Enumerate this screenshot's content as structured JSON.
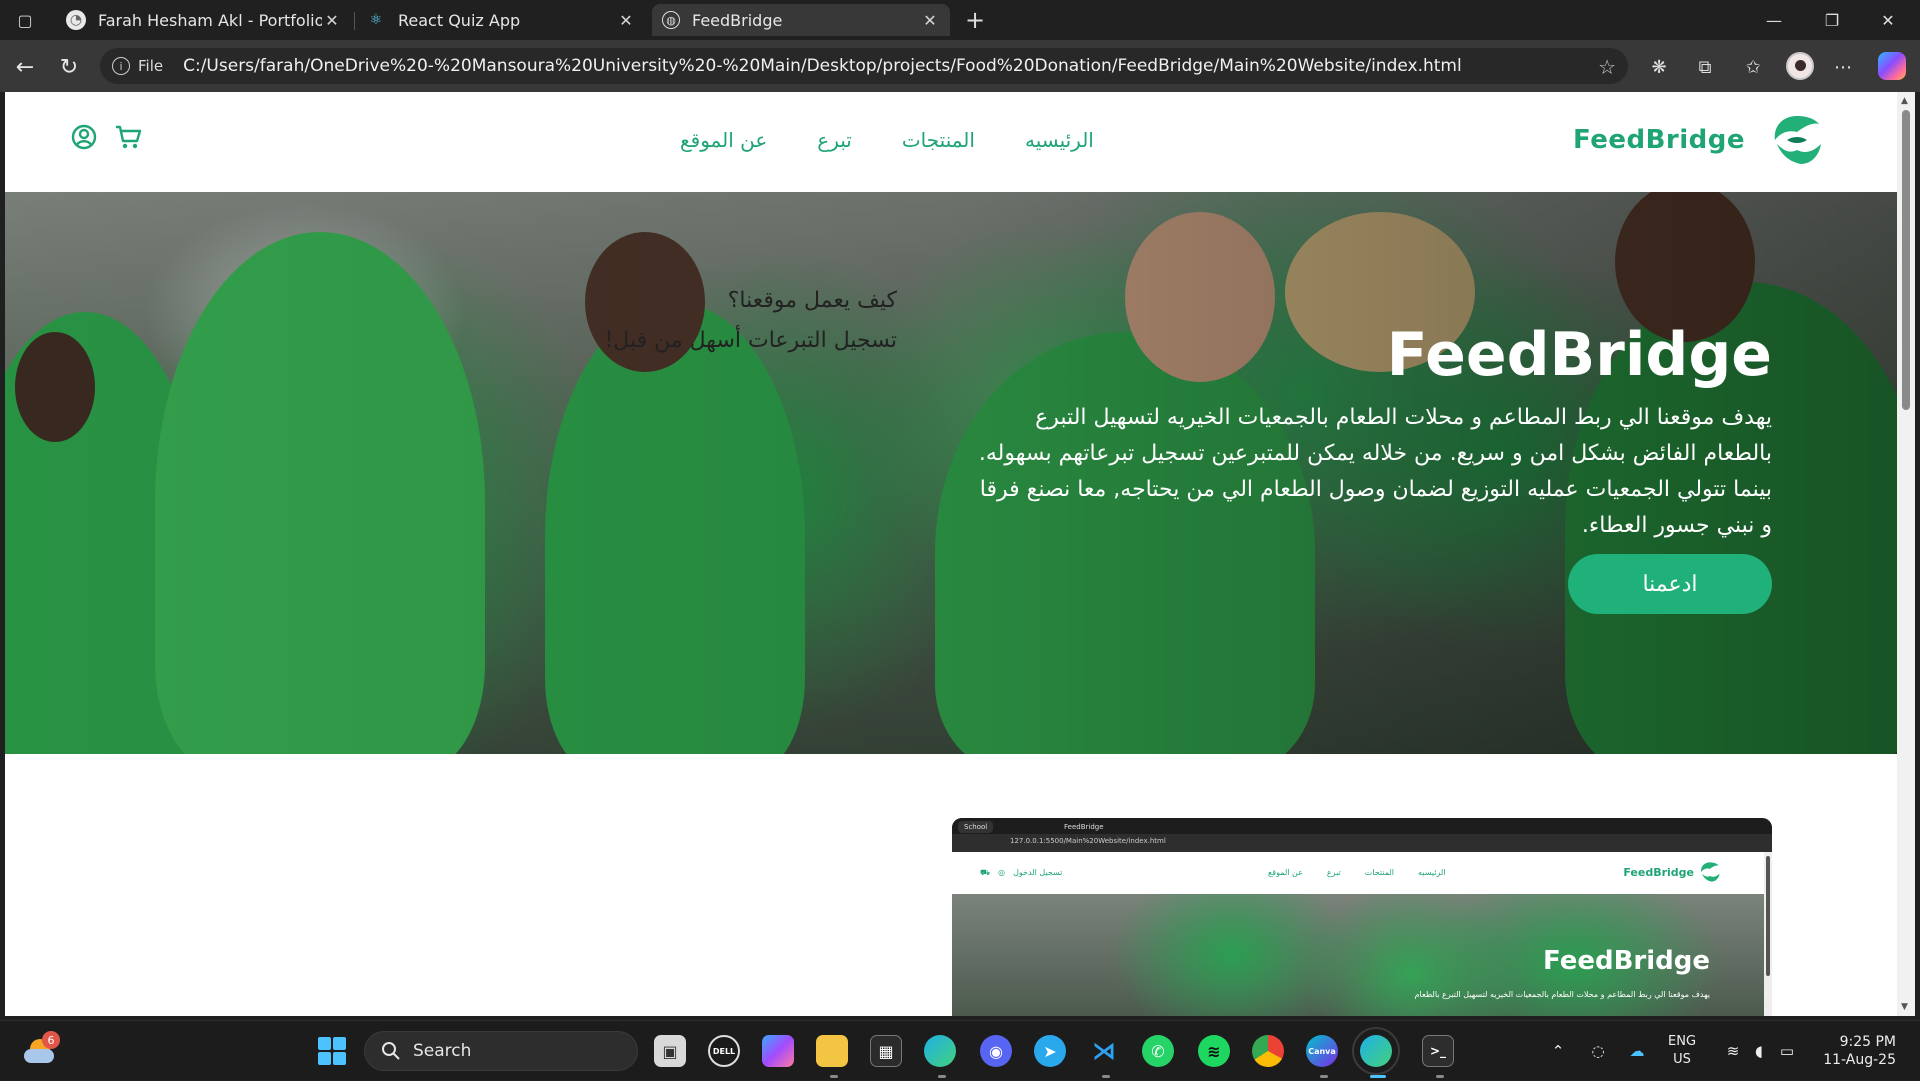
{
  "browser": {
    "tabs": [
      {
        "title": "Farah Hesham Akl - Portfolio",
        "active": false
      },
      {
        "title": "React Quiz App",
        "active": false
      },
      {
        "title": "FeedBridge",
        "active": true
      }
    ],
    "address": {
      "scheme_label": "File",
      "url": "C:/Users/farah/OneDrive%20-%20Mansoura%20University%20-%20Main/Desktop/projects/Food%20Donation/FeedBridge/Main%20Website/index.html"
    }
  },
  "site": {
    "brand": "FeedBridge",
    "nav": [
      "الرئيسيه",
      "المنتجات",
      "تبرع",
      "عن الموقع"
    ],
    "hero": {
      "title": "FeedBridge",
      "text": "يهدف موقعنا الي ربط المطاعم و محلات الطعام بالجمعيات الخيريه لتسهيل التبرع بالطعام الفائض بشكل امن و سريع. من خلاله يمكن للمتبرعين تسجيل تبرعاتهم بسهوله. بينما تتولي الجمعيات عمليه التوزيع لضمان وصول الطعام الي من يحتاجه, معا نصنع فرقا و نبني جسور العطاء.",
      "button": "ادعمنا"
    },
    "how": {
      "title": "كيف يعمل موقعنا؟",
      "subtitle": "تسجيل التبرعات أسهل من قبل!"
    },
    "preview": {
      "tab_school": "School",
      "tab_title": "FeedBridge",
      "url": "127.0.0.1:5500/Main%20Website/index.html",
      "brand": "FeedBridge",
      "nav": [
        "الرئيسيه",
        "المنتجات",
        "تبرع",
        "عن الموقع"
      ],
      "login": "تسجيل الدخول",
      "hero_title": "FeedBridge",
      "hero_text": "يهدف موقعنا الي ربط المطاعم و محلات الطعام بالجمعيات الخيريه لتسهيل التبرع بالطعام"
    }
  },
  "taskbar": {
    "search_placeholder": "Search",
    "weather_badge": "6",
    "lang_top": "ENG",
    "lang_bottom": "US",
    "time": "9:25 PM",
    "date": "11-Aug-25"
  },
  "colors": {
    "brand_green": "#1fa574",
    "button_green": "#20b07a"
  }
}
